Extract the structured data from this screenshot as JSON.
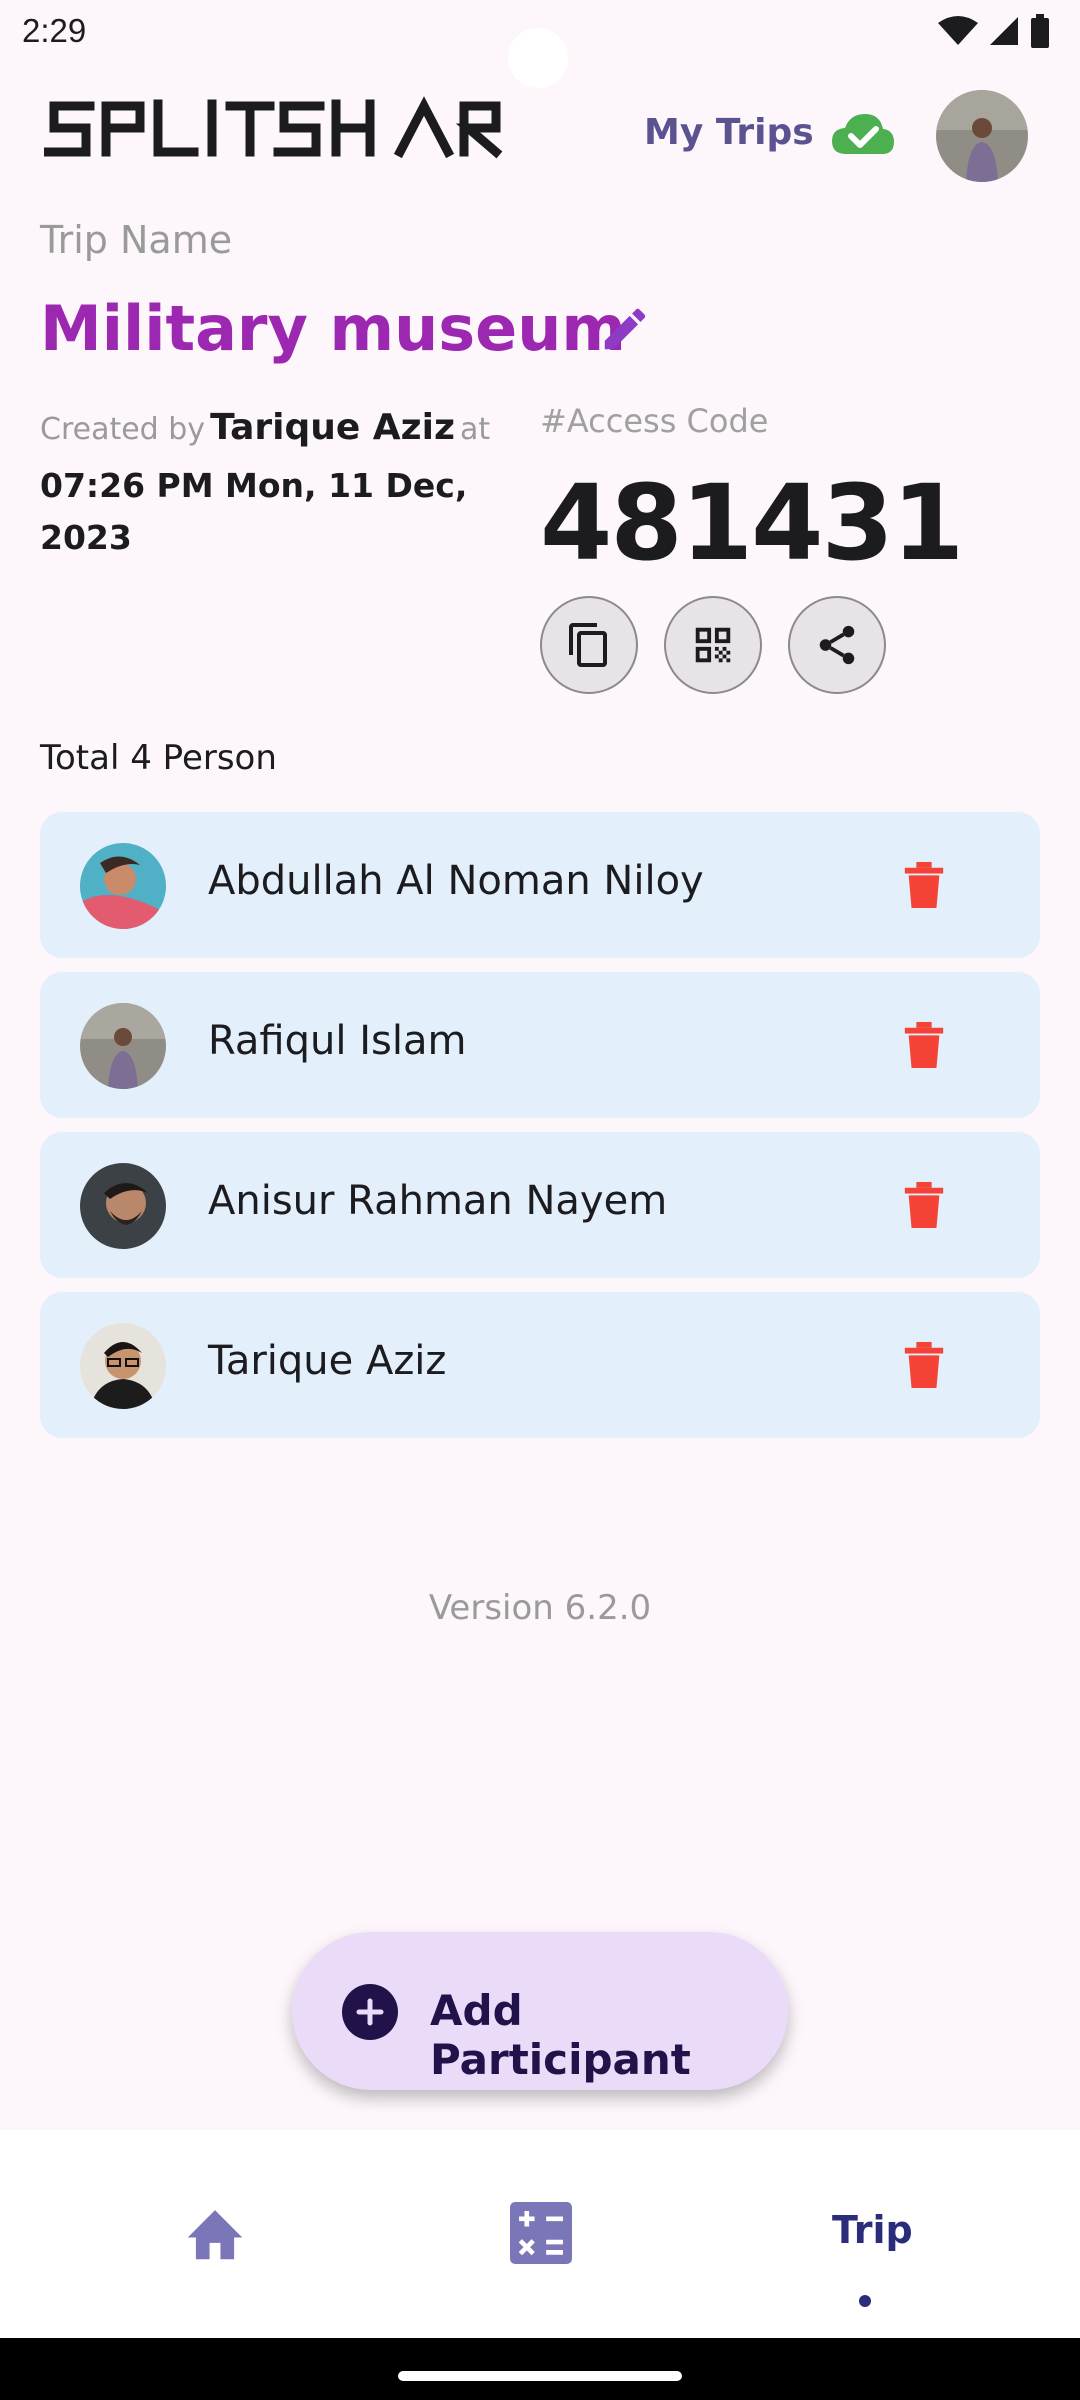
{
  "status_bar": {
    "time": "2:29"
  },
  "header": {
    "logo_text": "SPLITSHARE",
    "my_trips_label": "My Trips"
  },
  "trip": {
    "name_label": "Trip Name",
    "name": "Military museum",
    "created_by_prefix": "Created by",
    "creator": "Tarique Aziz",
    "at_label": "at",
    "created_date": "07:26 PM Mon, 11 Dec, 2023",
    "access_code_label": "#Access Code",
    "access_code": "481431"
  },
  "participants": {
    "total_label": "Total 4 Person",
    "items": [
      {
        "name": "Abdullah Al Noman Niloy"
      },
      {
        "name": "Rafiqul Islam"
      },
      {
        "name": "Anisur Rahman Nayem"
      },
      {
        "name": "Tarique Aziz"
      }
    ]
  },
  "version": "Version 6.2.0",
  "fab": {
    "label": "Add Participant"
  },
  "bottom_nav": {
    "trip_label": "Trip",
    "active": "Trip"
  },
  "colors": {
    "accent_purple": "#9c27b0",
    "my_trips": "#5b5290",
    "card_bg": "#e3effa",
    "delete_red": "#f44336",
    "nav_active": "#2b2d7a",
    "fab_bg": "#eadcf8",
    "cloud_green": "#4caf50"
  }
}
